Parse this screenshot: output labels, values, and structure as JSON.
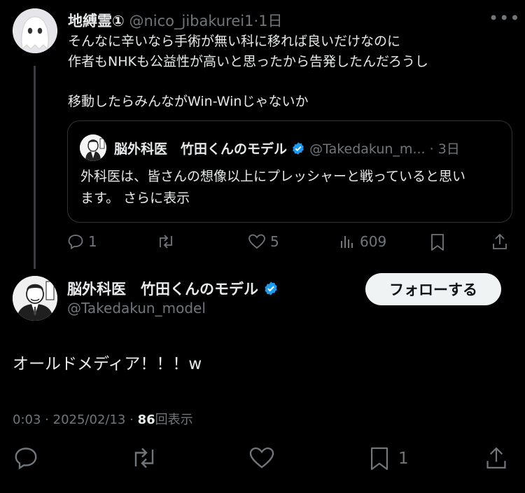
{
  "parent": {
    "display_name": "地縛霊①",
    "handle": "@nico_jibakurei1",
    "sep": "·",
    "time": "1日",
    "more": "•••",
    "lines": [
      "そんなに辛いなら手術が無い科に移れば良いだけなのに",
      "作者もNHKも公益性が高いと思ったから告発したんだろうし",
      "移動したらみんながWin-Winじゃないか"
    ],
    "actions": {
      "reply_count": "1",
      "retweet_count": "",
      "like_count": "5",
      "view_count": "609"
    }
  },
  "quote": {
    "display_name": "脳外科医　竹田くんのモデル",
    "handle": "@Takedakun_m...",
    "sep": "·",
    "time": "3日",
    "line1": "外科医は、皆さんの想像以上にプレッシャーと戦っていると思い",
    "line2": "ます。",
    "show_more": "さらに表示"
  },
  "main": {
    "display_name": "脳外科医　竹田くんのモデル",
    "handle": "@Takedakun_model",
    "follow_label": "フォローする",
    "text": "オールドメディア！！！w",
    "time": "0:03",
    "sep1": "·",
    "date": "2025/02/13",
    "sep2": "·",
    "views_count": "86",
    "views_label": "回表示",
    "bookmark_count": "1"
  },
  "colors": {
    "verified": "#1d9bf0",
    "background": "#000000",
    "text": "#e7e9ea",
    "muted": "#71767b"
  },
  "icons": [
    "reply-icon",
    "retweet-icon",
    "like-icon",
    "views-icon",
    "bookmark-icon",
    "share-icon",
    "verified-icon",
    "more-icon"
  ]
}
